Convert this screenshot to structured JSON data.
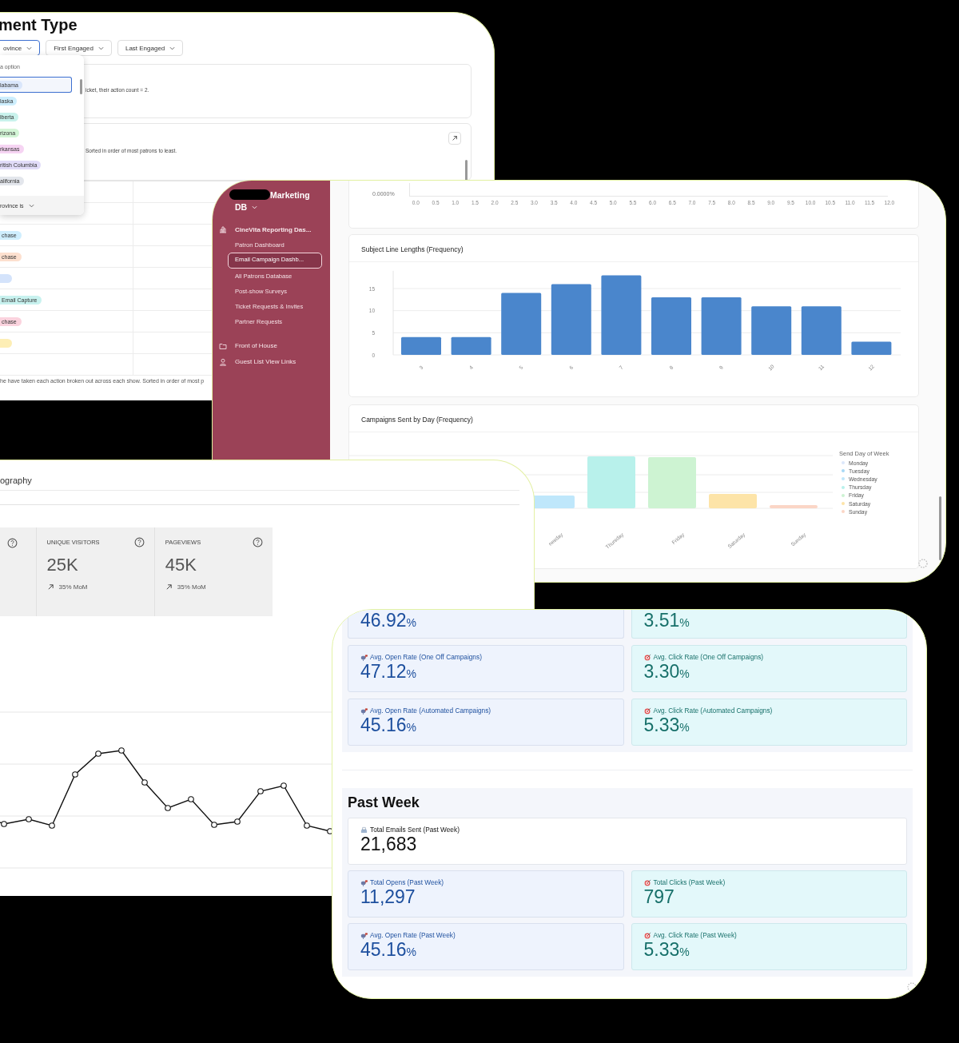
{
  "segment_panel": {
    "title": "ment Type",
    "filters": [
      {
        "label": "ovince",
        "selected": true
      },
      {
        "label": "First Engaged",
        "selected": false
      },
      {
        "label": "Last Engaged",
        "selected": false
      }
    ],
    "dropdown": {
      "search": {
        "placeholder": "a option"
      },
      "options": [
        {
          "label": "labama",
          "color": "#d9e6fb",
          "selected": true
        },
        {
          "label": "laska",
          "color": "#cdeefd",
          "selected": false
        },
        {
          "label": "lberta",
          "color": "#c9f2ec",
          "selected": false
        },
        {
          "label": "rizona",
          "color": "#d3f5d6",
          "selected": false
        },
        {
          "label": "rkansas",
          "color": "#f6d4f3",
          "selected": false
        },
        {
          "label": "ritish Columbia",
          "color": "#e1dcf8",
          "selected": false
        },
        {
          "label": "alifornia",
          "color": "#e3e6ec",
          "selected": false
        }
      ],
      "footer": "rovince is"
    },
    "cards": [
      {
        "text": "icket, their action count = 2."
      },
      {
        "text": "Sorted in order of most patrons to least."
      }
    ],
    "table_rows": [
      {
        "tag": "chase",
        "color": "#cfeefe"
      },
      {
        "tag": "chase",
        "color": "#fde0cf"
      },
      {
        "color": "#d4e3fb"
      },
      {
        "tag": "Email Capture",
        "color": "#c8f2ef"
      },
      {
        "tag": "chase",
        "color": "#fbd3de"
      },
      {
        "color": "#fdeeb5"
      }
    ],
    "footnote": "he have taken each action broken out across each show. Sorted in order of most p"
  },
  "reporting_panel": {
    "brand": "Marketing",
    "workspace": "DB",
    "nav": [
      {
        "label": "CineVita Reporting Das...",
        "selected": false,
        "children": [
          {
            "label": "Patron Dashboard",
            "selected": false
          },
          {
            "label": "Email Campaign Dashb...",
            "selected": true
          },
          {
            "label": "All Patrons Database",
            "selected": false
          },
          {
            "label": "Post-show Surveys",
            "selected": false
          },
          {
            "label": "Ticket Requests & Invites",
            "selected": false
          },
          {
            "label": "Partner Requests",
            "selected": false
          }
        ]
      },
      {
        "label": "Front of House",
        "selected": false
      },
      {
        "label": "Guest List View Links",
        "selected": false
      }
    ],
    "top_chart": {
      "y_label": "0.0000%",
      "x_ticks": [
        "0.0",
        "0.5",
        "1.0",
        "1.5",
        "2.0",
        "2.5",
        "3.0",
        "3.5",
        "4.0",
        "4.5",
        "5.0",
        "5.5",
        "6.0",
        "6.5",
        "7.0",
        "7.5",
        "8.0",
        "8.5",
        "9.0",
        "9.5",
        "10.0",
        "10.5",
        "11.0",
        "11.5",
        "12.0"
      ]
    },
    "subject_chart": {
      "chart_data": {
        "type": "bar",
        "title": "Subject Line Lengths (Frequency)",
        "categories": [
          "3",
          "4",
          "5",
          "6",
          "7",
          "8",
          "9",
          "10",
          "11",
          "12"
        ],
        "values": [
          4,
          4,
          14,
          16,
          18,
          13,
          13,
          11,
          11,
          3
        ],
        "yticks": [
          0,
          5,
          10,
          15
        ],
        "ylim": [
          0,
          19
        ],
        "grid": true
      }
    },
    "day_chart": {
      "title": "Campaigns Sent by Day (Frequency)",
      "x_labels": [
        "nesday",
        "Thursday",
        "Friday",
        "Saturday",
        "Sunday"
      ],
      "legend": {
        "title": "Send Day of Week",
        "items": [
          {
            "label": "Monday",
            "color": "#dce8fb"
          },
          {
            "label": "Tuesday",
            "color": "#a8d9f5"
          },
          {
            "label": "Wednesday",
            "color": "#bfe7fb"
          },
          {
            "label": "Thursday",
            "color": "#b8f1eb"
          },
          {
            "label": "Friday",
            "color": "#cdf3d2"
          },
          {
            "label": "Saturday",
            "color": "#fde4a8"
          },
          {
            "label": "Sunday",
            "color": "#fbd6c6"
          }
        ]
      }
    }
  },
  "traffic_panel": {
    "title": "ography",
    "stats": [
      {
        "label": "UNIQUE VISITORS",
        "value": "25K",
        "change": "35% MoM"
      },
      {
        "label": "PAGEVIEWS",
        "value": "45K",
        "change": "35% MoM"
      }
    ]
  },
  "email_panel": {
    "metric_rows": [
      {
        "cards": [
          {
            "kind": "open",
            "value": "46.92",
            "unit": "%"
          },
          {
            "kind": "click",
            "value": "3.51",
            "unit": "%"
          }
        ]
      },
      {
        "cards": [
          {
            "kind": "open",
            "label": "Avg. Open Rate (One Off Campaigns)",
            "value": "47.12",
            "unit": "%"
          },
          {
            "kind": "click",
            "label": "Avg. Click Rate (One Off Campaigns)",
            "value": "3.30",
            "unit": "%"
          }
        ]
      },
      {
        "cards": [
          {
            "kind": "open",
            "label": "Avg. Open Rate (Automated Campaigns)",
            "value": "45.16",
            "unit": "%"
          },
          {
            "kind": "click",
            "label": "Avg. Click Rate (Automated Campaigns)",
            "value": "5.33",
            "unit": "%"
          }
        ]
      }
    ],
    "past_week": {
      "title": "Past Week",
      "rows": [
        {
          "cards": [
            {
              "kind": "sent",
              "label": "Total Emails Sent (Past Week)",
              "value": "21,683"
            }
          ]
        },
        {
          "cards": [
            {
              "kind": "open",
              "label": "Total Opens (Past Week)",
              "value": "11,297"
            },
            {
              "kind": "click",
              "label": "Total Clicks (Past Week)",
              "value": "797"
            }
          ]
        },
        {
          "cards": [
            {
              "kind": "open",
              "label": "Avg. Open Rate (Past Week)",
              "value": "45.16",
              "unit": "%"
            },
            {
              "kind": "click",
              "label": "Avg. Click Rate (Past Week)",
              "value": "5.33",
              "unit": "%"
            }
          ]
        }
      ]
    }
  }
}
